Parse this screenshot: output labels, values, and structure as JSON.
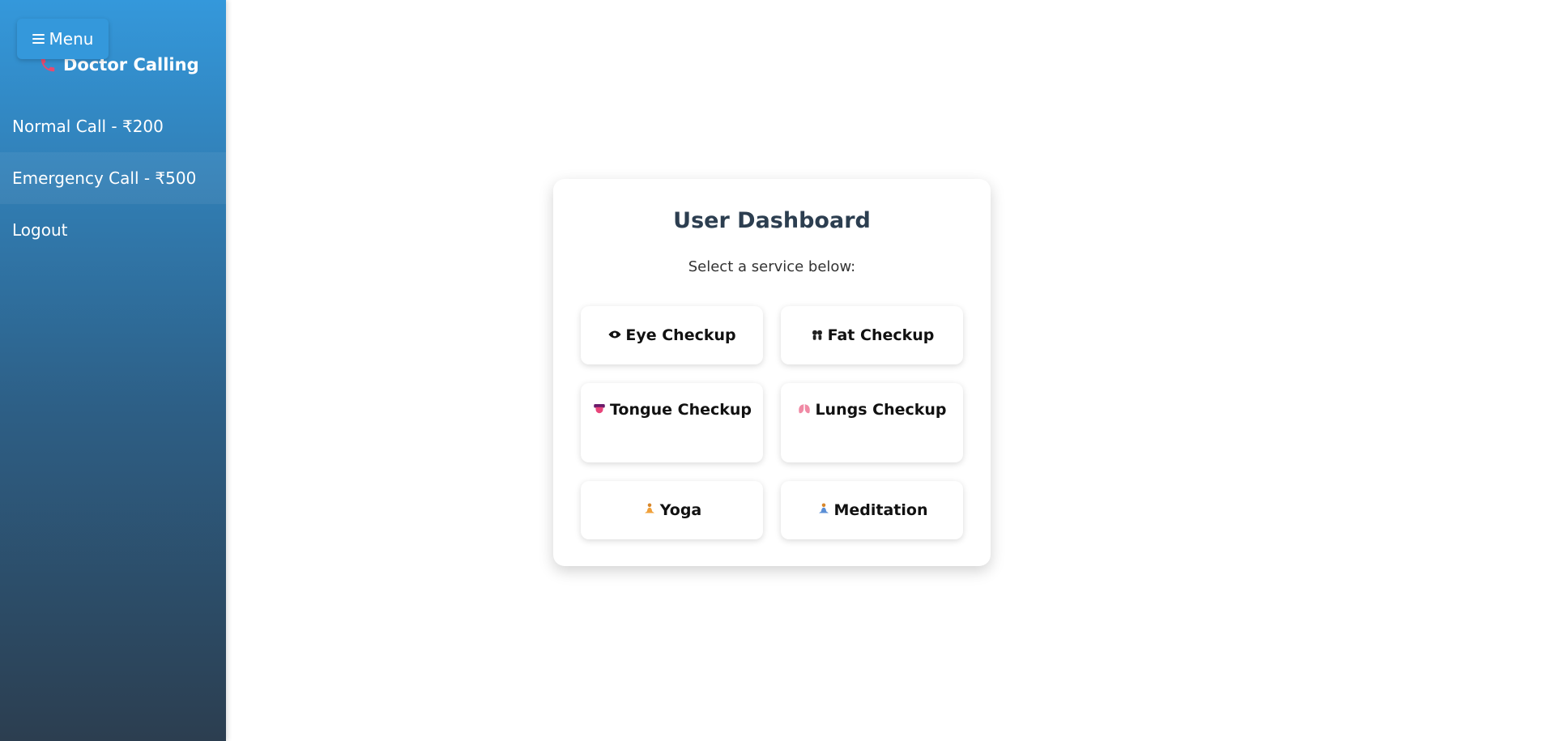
{
  "sidebar": {
    "menu_label": "Menu",
    "brand": "Doctor Calling",
    "items": [
      {
        "label": "Normal Call - ₹200"
      },
      {
        "label": "Emergency Call - ₹500"
      },
      {
        "label": "Logout"
      }
    ]
  },
  "dashboard": {
    "title": "User Dashboard",
    "subtitle": "Select a service below:",
    "services": [
      {
        "label": "Eye Checkup",
        "icon": "eye-icon"
      },
      {
        "label": "Fat Checkup",
        "icon": "dumbbell-icon"
      },
      {
        "label": "Tongue Checkup",
        "icon": "tongue-icon"
      },
      {
        "label": "Lungs Checkup",
        "icon": "lungs-icon"
      },
      {
        "label": "Yoga",
        "icon": "yoga-icon"
      },
      {
        "label": "Meditation",
        "icon": "meditation-icon"
      }
    ]
  },
  "colors": {
    "sidebar_top": "#3498db",
    "sidebar_bottom": "#2c3e50",
    "title": "#2c3e50",
    "phone_icon": "#e74c3c"
  }
}
